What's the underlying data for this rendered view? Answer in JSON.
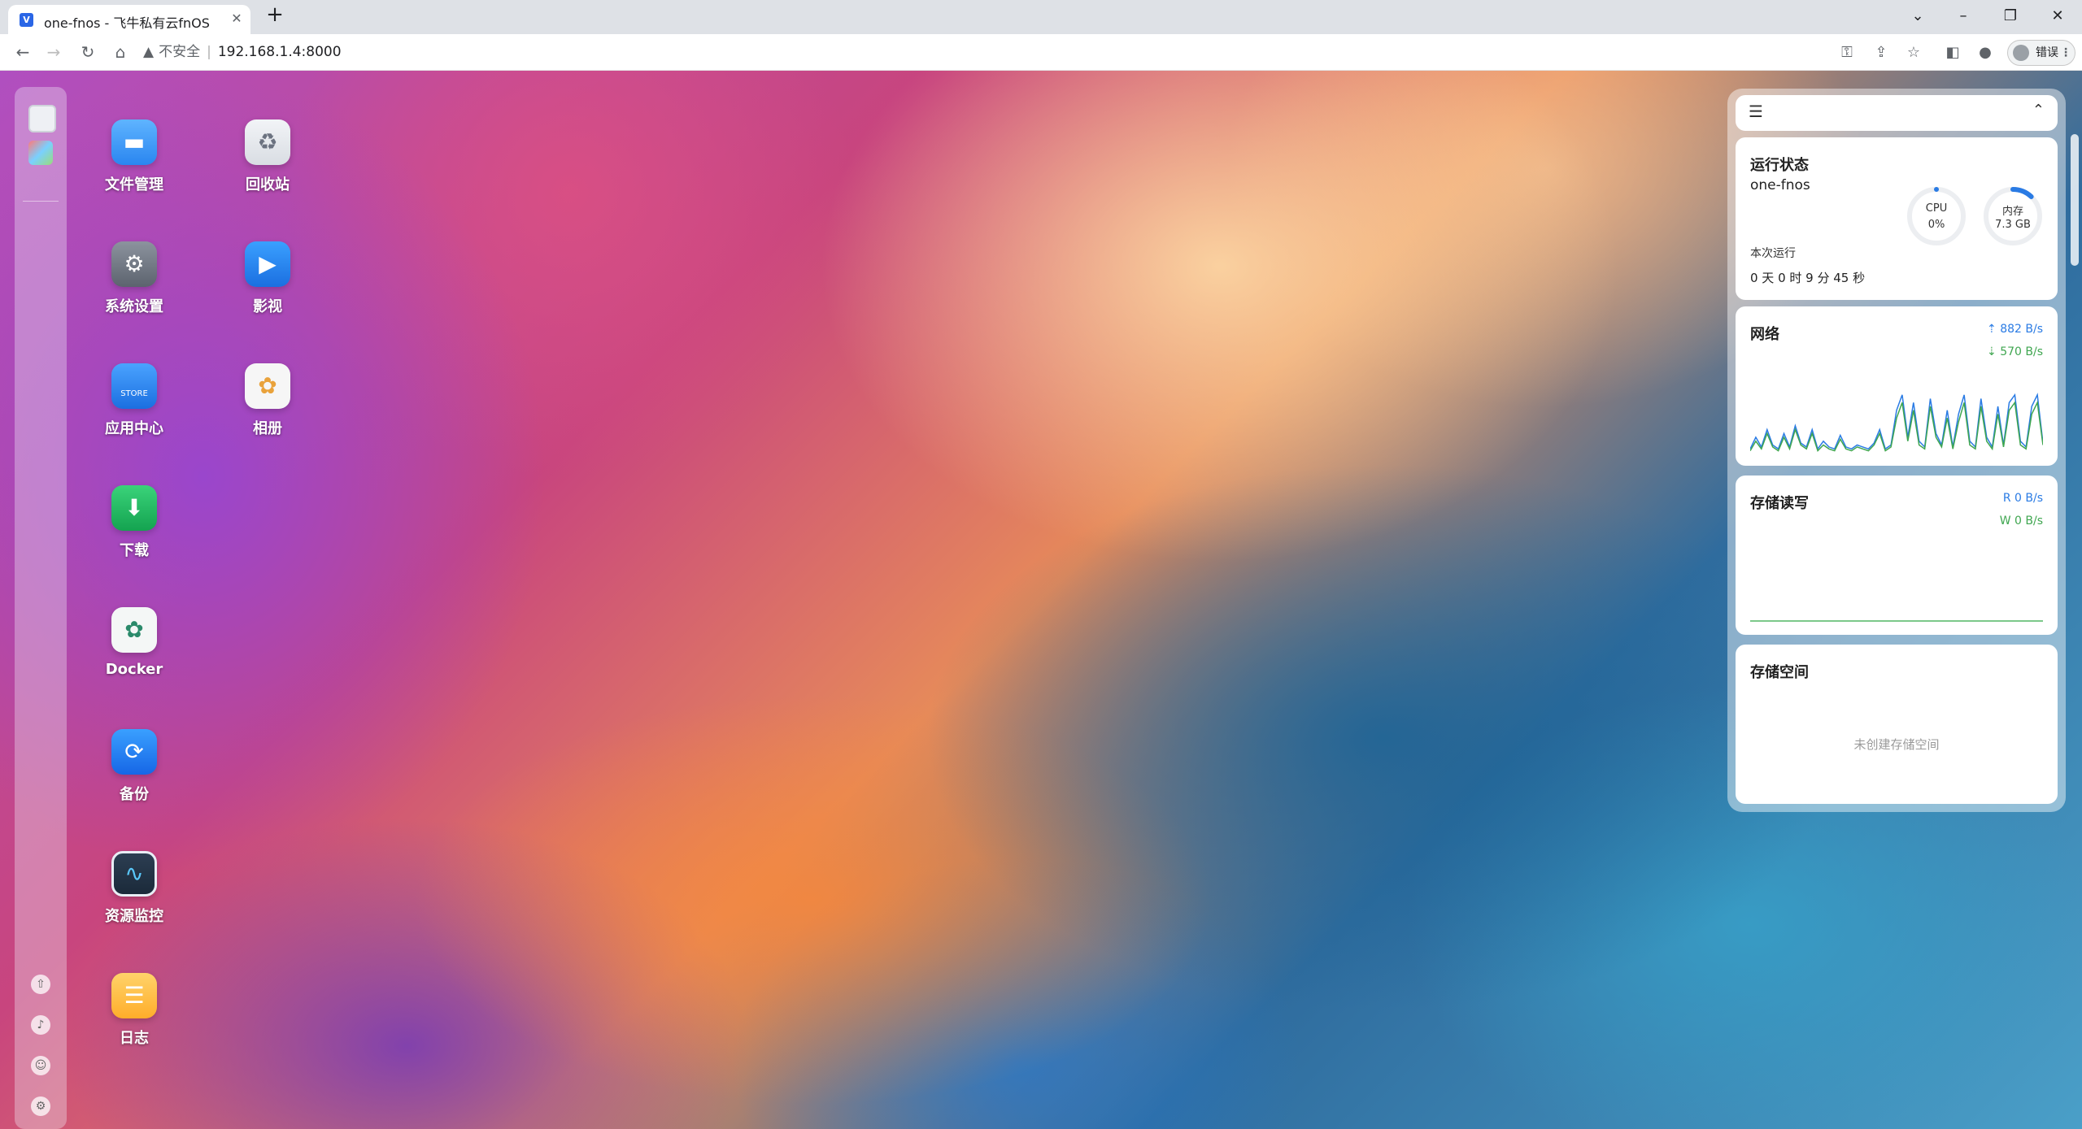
{
  "browser": {
    "tab_title": "one-fnos - 飞牛私有云fnOS",
    "tab_close": "✕",
    "new_tab": "+",
    "controls": {
      "dropdown": "⌄",
      "minimize": "–",
      "restore": "❐",
      "close": "✕"
    },
    "url": {
      "warning_icon": "▲",
      "insecure_label": "不安全",
      "separator": "|",
      "address": "192.168.1.4:8000"
    },
    "error_button": "错误",
    "more": "⋮"
  },
  "sidebar": {
    "items": [
      {
        "name": "desktop",
        "icon": "monitor-icon"
      },
      {
        "name": "app-launcher",
        "icon": "grid-icon"
      }
    ],
    "bottom_icons": [
      "upload-icon",
      "bell-icon",
      "user-icon",
      "gear-icon"
    ]
  },
  "apps": [
    {
      "label": "文件管理",
      "icon": "folder-icon"
    },
    {
      "label": "回收站",
      "icon": "recycle-icon"
    },
    {
      "label": "系统设置",
      "icon": "settings-icon"
    },
    {
      "label": "影视",
      "icon": "video-icon"
    },
    {
      "label": "应用中心",
      "icon": "store-icon",
      "badge": "STORE"
    },
    {
      "label": "相册",
      "icon": "photos-icon"
    },
    {
      "label": "下载",
      "icon": "download-icon"
    },
    {
      "label": "Docker",
      "icon": "docker-icon"
    },
    {
      "label": "备份",
      "icon": "backup-icon"
    },
    {
      "label": "资源监控",
      "icon": "monitor-chart-icon"
    },
    {
      "label": "日志",
      "icon": "log-icon"
    }
  ],
  "widgets": {
    "status": {
      "title": "运行状态",
      "hostname": "one-fnos",
      "cpu": {
        "label": "CPU",
        "value": "0%",
        "fraction": 0.0
      },
      "memory": {
        "label": "内存",
        "value": "7.3 GB",
        "fraction": 0.12
      },
      "uptime_label": "本次运行",
      "uptime": "0 天 0 时 9 分 45 秒"
    },
    "network": {
      "title": "网络",
      "up": "882 B/s",
      "down": "570 B/s",
      "chart_data": {
        "type": "line",
        "series": [
          {
            "color": "#2a7be4",
            "values": [
              2,
              8,
              3,
              12,
              4,
              2,
              10,
              3,
              14,
              5,
              3,
              12,
              2,
              6,
              3,
              2,
              9,
              3,
              2,
              4,
              3,
              2,
              5,
              12,
              2,
              4,
              22,
              30,
              8,
              26,
              6,
              3,
              28,
              10,
              4,
              22,
              3,
              20,
              30,
              6,
              3,
              28,
              8,
              3,
              24,
              4,
              26,
              30,
              6,
              3,
              24,
              30,
              5
            ]
          },
          {
            "color": "#3fa650",
            "values": [
              1,
              6,
              2,
              10,
              3,
              1,
              8,
              2,
              12,
              4,
              2,
              10,
              1,
              4,
              2,
              1,
              7,
              2,
              1,
              3,
              2,
              1,
              4,
              10,
              1,
              3,
              18,
              26,
              6,
              22,
              4,
              2,
              24,
              8,
              3,
              18,
              2,
              16,
              26,
              4,
              2,
              24,
              6,
              2,
              20,
              3,
              22,
              26,
              4,
              2,
              20,
              26,
              4
            ]
          }
        ]
      }
    },
    "storage_io": {
      "title": "存储读写",
      "read": "R  0 B/s",
      "write": "W  0 B/s"
    },
    "storage_space": {
      "title": "存储空间",
      "empty": "未创建存储空间"
    }
  }
}
